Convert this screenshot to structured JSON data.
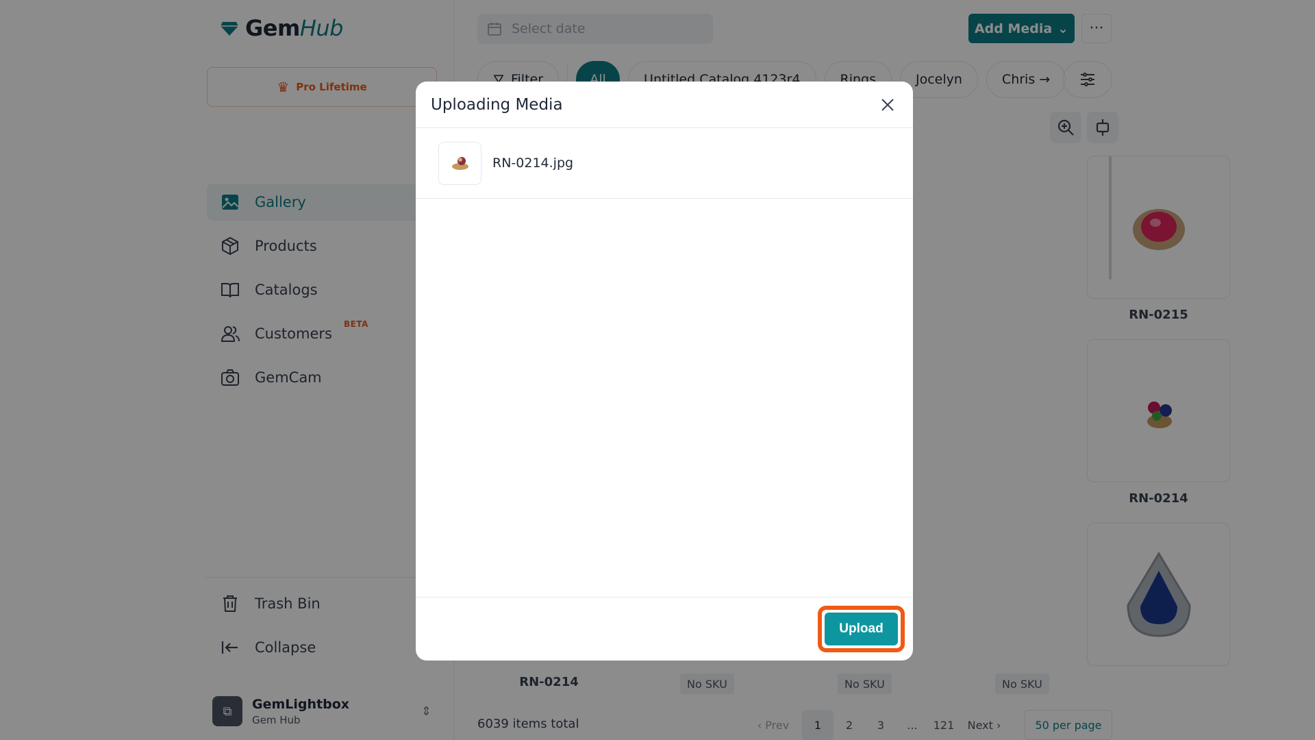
{
  "brand": {
    "name_part1": "Gem",
    "name_part2": "Hub"
  },
  "plan": {
    "label": "Pro Lifetime"
  },
  "sidebar": {
    "items": [
      {
        "label": "Gallery"
      },
      {
        "label": "Products"
      },
      {
        "label": "Catalogs"
      },
      {
        "label": "Customers",
        "badge": "BETA"
      },
      {
        "label": "GemCam"
      }
    ],
    "bottom": [
      {
        "label": "Trash Bin"
      },
      {
        "label": "Collapse"
      }
    ],
    "workspace": {
      "name": "GemLightbox",
      "subtitle": "Gem Hub"
    }
  },
  "toolbar": {
    "date_placeholder": "Select date",
    "add_media_label": "Add Media",
    "more_label": "···"
  },
  "filters": {
    "filter_label": "Filter",
    "chips": [
      "All",
      "Untitled Catalog 4123r4",
      "Rings",
      "Jocelyn",
      "Chris"
    ]
  },
  "grid": {
    "labels": [
      "RN-0215",
      "RN-0214",
      "RN-0214",
      "No SKU",
      "No SKU",
      "No SKU"
    ]
  },
  "footer": {
    "total": "6039 items total",
    "prev": "‹ Prev",
    "pages": [
      "1",
      "2",
      "3",
      "...",
      "121"
    ],
    "next": "Next ›",
    "per_page": "50 per page"
  },
  "modal": {
    "title": "Uploading Media",
    "file_name": "RN-0214.jpg",
    "upload_label": "Upload"
  },
  "colors": {
    "brand": "#0e7c86",
    "accent": "#e8591d",
    "highlight_ring": "#f05a14",
    "upload_button": "#0e96a0"
  }
}
